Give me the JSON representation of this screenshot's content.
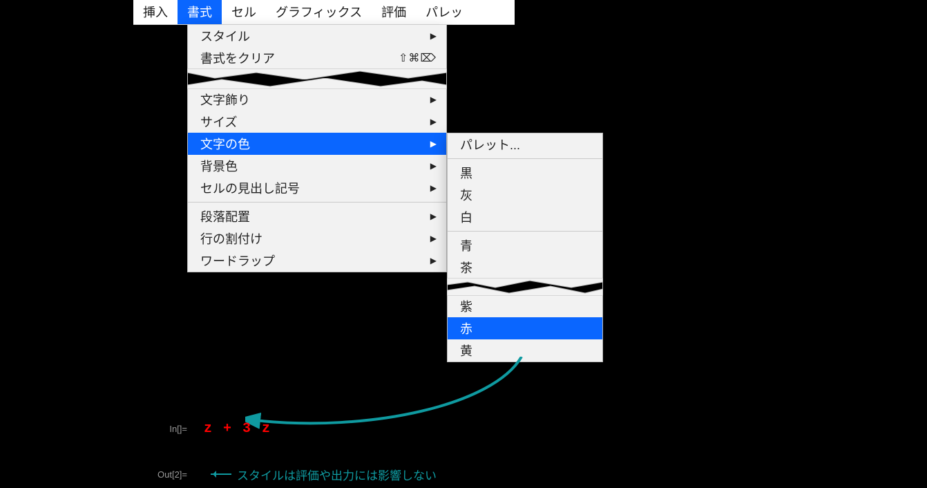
{
  "menubar": {
    "items": [
      {
        "label": "挿入"
      },
      {
        "label": "書式",
        "active": true
      },
      {
        "label": "セル"
      },
      {
        "label": "グラフィックス"
      },
      {
        "label": "評価"
      },
      {
        "label": "パレッ"
      }
    ]
  },
  "dropdown": {
    "group1": [
      {
        "label": "スタイル",
        "arrow": true
      },
      {
        "label": "書式をクリア",
        "shortcut": "⇧⌘⌦"
      }
    ],
    "group2": [
      {
        "label": "文字飾り",
        "arrow": true
      },
      {
        "label": "サイズ",
        "arrow": true
      },
      {
        "label": "文字の色",
        "arrow": true,
        "highlighted": true
      },
      {
        "label": "背景色",
        "arrow": true
      },
      {
        "label": "セルの見出し記号",
        "arrow": true
      }
    ],
    "group3": [
      {
        "label": "段落配置",
        "arrow": true
      },
      {
        "label": "行の割付け",
        "arrow": true
      },
      {
        "label": "ワードラップ",
        "arrow": true
      }
    ]
  },
  "submenu": {
    "top": [
      {
        "label": "パレット..."
      }
    ],
    "grp1": [
      {
        "label": "黒"
      },
      {
        "label": "灰"
      },
      {
        "label": "白"
      }
    ],
    "grp2": [
      {
        "label": "青"
      },
      {
        "label": "茶"
      }
    ],
    "grp3": [
      {
        "label": "紫"
      },
      {
        "label": "赤",
        "highlighted": true
      },
      {
        "label": "黄"
      }
    ]
  },
  "notebook": {
    "in_label": "In[]=",
    "in_expr": "z + 3 z",
    "out_label": "Out[2]=",
    "note": "スタイルは評価や出力には影響しない"
  }
}
